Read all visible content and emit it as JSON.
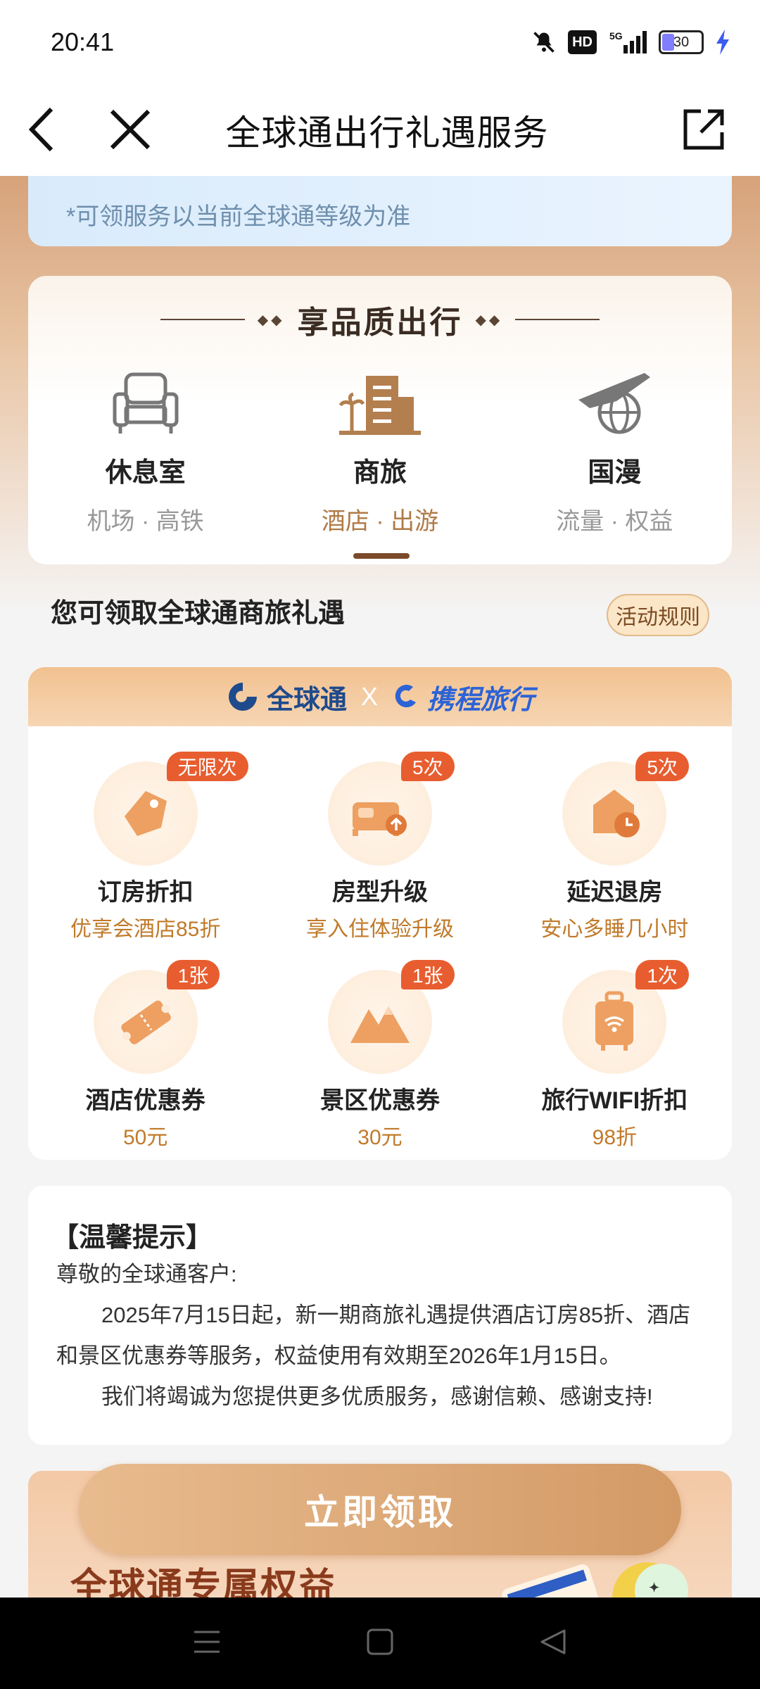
{
  "status_bar": {
    "time": "20:41",
    "network": "5G",
    "hd": "HD",
    "battery": "30",
    "icons": [
      "mute-icon",
      "hd-icon",
      "signal-5g-icon",
      "battery-icon",
      "charging-icon"
    ]
  },
  "nav": {
    "title": "全球通出行礼遇服务",
    "icons": [
      "back-icon",
      "close-icon",
      "share-icon"
    ]
  },
  "notice": {
    "text": "*可领服务以当前全球通等级为准"
  },
  "travel": {
    "heading": "享品质出行",
    "categories": [
      {
        "name": "休息室",
        "sub": "机场 · 高铁",
        "icon": "lounge-chair-icon"
      },
      {
        "name": "商旅",
        "sub": "酒店 · 出游",
        "icon": "business-travel-icon",
        "active": true
      },
      {
        "name": "国漫",
        "sub": "流量 · 权益",
        "icon": "global-roaming-icon"
      }
    ]
  },
  "section": {
    "title": "您可领取全球通商旅礼遇",
    "rules_button": "活动规则"
  },
  "benefits": {
    "partner_a": "全球通",
    "separator": "X",
    "partner_b": "携程旅行",
    "items": [
      {
        "badge": "无限次",
        "name": "订房折扣",
        "desc": "优享会酒店85折",
        "icon": "discount-tag-icon"
      },
      {
        "badge": "5次",
        "name": "房型升级",
        "desc": "享入住体验升级",
        "icon": "bed-upgrade-icon"
      },
      {
        "badge": "5次",
        "name": "延迟退房",
        "desc": "安心多睡几小时",
        "icon": "late-checkout-icon"
      },
      {
        "badge": "1张",
        "name": "酒店优惠券",
        "desc": "50元",
        "icon": "hotel-coupon-icon"
      },
      {
        "badge": "1张",
        "name": "景区优惠券",
        "desc": "30元",
        "icon": "scenic-mountain-icon"
      },
      {
        "badge": "1次",
        "name": "旅行WIFI折扣",
        "desc": "98折",
        "icon": "wifi-luggage-icon"
      }
    ]
  },
  "tips": {
    "title": "【温馨提示】",
    "greeting": "尊敬的全球通客户:",
    "para1": "2025年7月15日起，新一期商旅礼遇提供酒店订房85折、酒店和景区优惠券等服务，权益使用有效期至2026年1月15日。",
    "para2": "我们将竭诚为您提供更多优质服务，感谢信赖、感谢支持!"
  },
  "cta": {
    "label": "立即领取"
  },
  "promo": {
    "title": "全球通专属权益"
  },
  "colors": {
    "accent": "#b07a46",
    "badge": "#e85d2f",
    "cta": "#d39a66"
  }
}
